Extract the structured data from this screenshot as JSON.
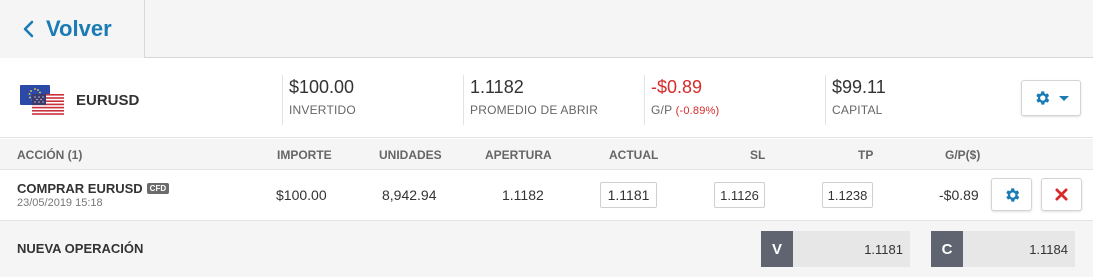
{
  "nav": {
    "back_label": "Volver"
  },
  "instrument": {
    "symbol": "EURUSD"
  },
  "stats": {
    "invested": {
      "value": "$100.00",
      "label": "INVERTIDO"
    },
    "avg_open": {
      "value": "1.1182",
      "label": "PROMEDIO DE ABRIR"
    },
    "pl": {
      "value": "-$0.89",
      "label": "G/P",
      "pct": "(-0.89%)"
    },
    "equity": {
      "value": "$99.11",
      "label": "CAPITAL"
    }
  },
  "table": {
    "headers": {
      "action": "ACCIÓN (1)",
      "amount": "IMPORTE",
      "units": "UNIDADES",
      "open": "APERTURA",
      "current": "ACTUAL",
      "sl": "SL",
      "tp": "TP",
      "pl": "G/P($)"
    },
    "rows": [
      {
        "action": "COMPRAR EURUSD",
        "badge": "CFD",
        "date": "23/05/2019 15:18",
        "amount": "$100.00",
        "units": "8,942.94",
        "open": "1.1182",
        "current": "1.1181",
        "sl": "1.1126",
        "tp": "1.1238",
        "pl": "-$0.89"
      }
    ]
  },
  "new_operation": {
    "label": "NUEVA OPERACIÓN",
    "sell": {
      "letter": "V",
      "price": "1.1181"
    },
    "buy": {
      "letter": "C",
      "price": "1.1184"
    }
  },
  "colors": {
    "accent": "#1a7bb5",
    "negative": "#d62b2b",
    "trade_letter_bg": "#5f6470"
  },
  "icons": [
    "chevron-left-icon",
    "eu-us-flag-icon",
    "gear-icon",
    "caret-down-icon",
    "close-icon"
  ]
}
